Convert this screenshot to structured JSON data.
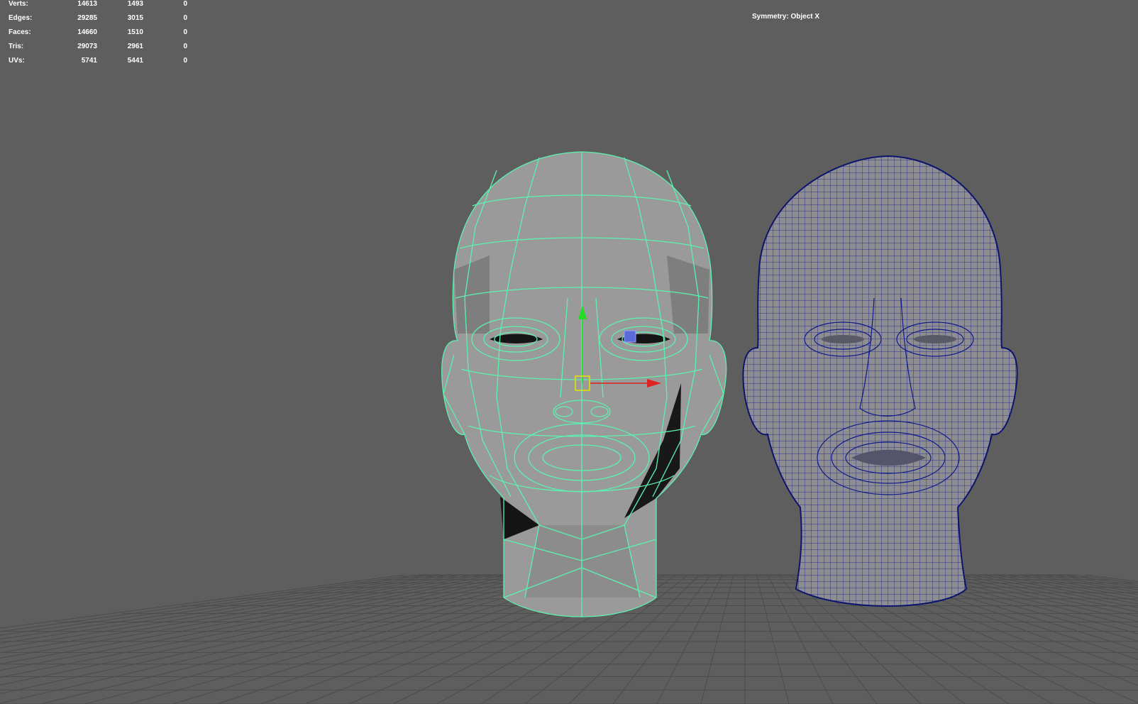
{
  "hud": {
    "rows": [
      {
        "label": "Verts:",
        "values": [
          "14613",
          "1493",
          "0"
        ]
      },
      {
        "label": "Edges:",
        "values": [
          "29285",
          "3015",
          "0"
        ]
      },
      {
        "label": "Faces:",
        "values": [
          "14660",
          "1510",
          "0"
        ]
      },
      {
        "label": "Tris:",
        "values": [
          "29073",
          "2961",
          "0"
        ]
      },
      {
        "label": "UVs:",
        "values": [
          "5741",
          "5441",
          "0"
        ]
      }
    ]
  },
  "viewport": {
    "symmetry_label": "Symmetry: Object X",
    "colors": {
      "background": "#5e5e5e",
      "grid": "#4a4a4a",
      "lowpoly_wire": "#5cf2b0",
      "lowpoly_fill": "#9a9a9a",
      "highpoly_wire": "#101a8a",
      "highpoly_fill": "#8e8e92",
      "gizmo_y": "#22dd22",
      "gizmo_x": "#dd2222",
      "gizmo_center": "#e6e600"
    },
    "objects": [
      {
        "name": "lowpoly-head",
        "icon": "mesh-wireframe"
      },
      {
        "name": "highpoly-head",
        "icon": "mesh-wireframe"
      }
    ]
  }
}
